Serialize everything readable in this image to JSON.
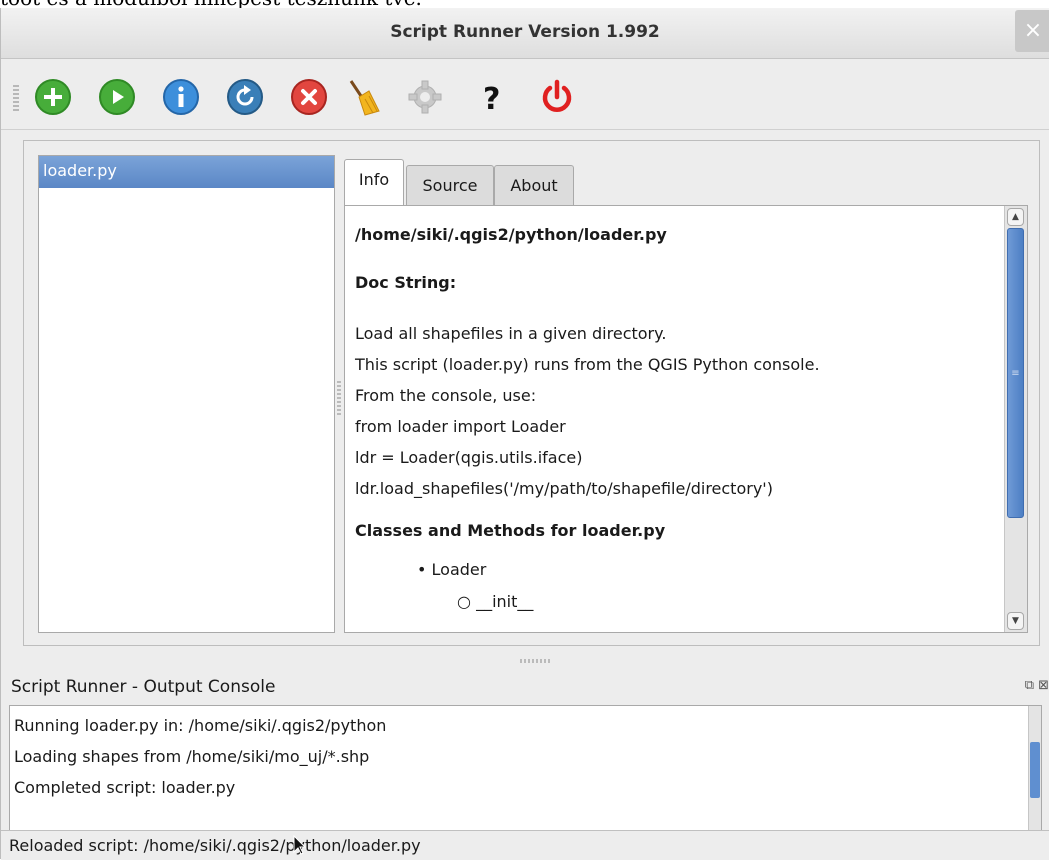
{
  "background_text": "toot és a modulból nincpest tesznünk tve.",
  "window": {
    "title": "Script Runner Version 1.992",
    "close_label": "×"
  },
  "toolbar": {
    "buttons": [
      {
        "name": "add-script-button",
        "icon": "plus-circle-green"
      },
      {
        "name": "run-script-button",
        "icon": "play-circle-green"
      },
      {
        "name": "info-button",
        "icon": "info-circle-blue"
      },
      {
        "name": "reload-button",
        "icon": "reload-circle-blue"
      },
      {
        "name": "remove-script-button",
        "icon": "x-circle-red"
      },
      {
        "name": "clear-console-button",
        "icon": "broom"
      },
      {
        "name": "preferences-button",
        "icon": "gear-disabled"
      },
      {
        "name": "help-button",
        "icon": "question-mark"
      },
      {
        "name": "exit-button",
        "icon": "power-red"
      }
    ]
  },
  "script_list": {
    "items": [
      "loader.py"
    ],
    "selected": "loader.py"
  },
  "tabs": [
    {
      "label": "Info",
      "active": true
    },
    {
      "label": "Source",
      "active": false
    },
    {
      "label": "About",
      "active": false
    }
  ],
  "info": {
    "path": "/home/siki/.qgis2/python/loader.py",
    "doc_heading": "Doc String:",
    "doc_lines": [
      "Load all shapefiles in a given directory.",
      "This script (loader.py) runs from the QGIS Python console.",
      "From the console, use:",
      "from loader import Loader",
      "ldr = Loader(qgis.utils.iface)",
      "ldr.load_shapefiles('/my/path/to/shapefile/directory')"
    ],
    "classes_heading": "Classes and Methods for loader.py",
    "classes": [
      {
        "bullet": "•",
        "text": "Loader"
      },
      {
        "bullet": "○",
        "text": "__init__"
      }
    ]
  },
  "console": {
    "title": "Script Runner - Output Console",
    "lines": [
      "Running loader.py in: /home/siki/.qgis2/python",
      "Loading shapes from /home/siki/mo_uj/*.shp",
      "Completed script: loader.py"
    ]
  },
  "status": {
    "text": "Reloaded script: /home/siki/.qgis2/python/loader.py"
  },
  "colors": {
    "selection": "#6a95cf",
    "green": "#3fa535",
    "blue": "#2f7fc8",
    "red": "#d9302a"
  }
}
